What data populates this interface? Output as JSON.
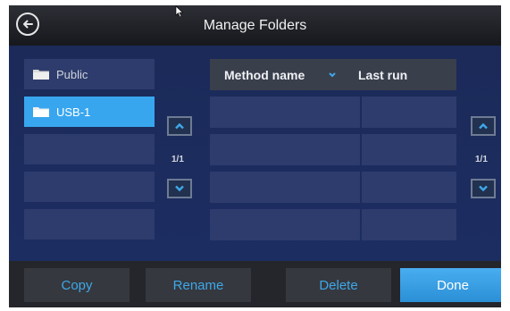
{
  "header": {
    "title": "Manage Folders"
  },
  "folders": [
    {
      "label": "Public",
      "selected": false
    },
    {
      "label": "USB-1",
      "selected": true
    },
    {
      "label": "",
      "selected": false
    },
    {
      "label": "",
      "selected": false
    },
    {
      "label": "",
      "selected": false
    }
  ],
  "folder_pager": "1/1",
  "methods_table": {
    "columns": [
      "Method name",
      "Last run"
    ],
    "rows": [
      [
        "",
        ""
      ],
      [
        "",
        ""
      ],
      [
        "",
        ""
      ],
      [
        "",
        ""
      ]
    ]
  },
  "methods_pager": "1/1",
  "actions": {
    "copy": "Copy",
    "rename": "Rename",
    "delete": "Delete",
    "done": "Done"
  },
  "colors": {
    "selected": "#38a6ef",
    "accent_text": "#3ea8e8",
    "background": "#1b2a58"
  }
}
